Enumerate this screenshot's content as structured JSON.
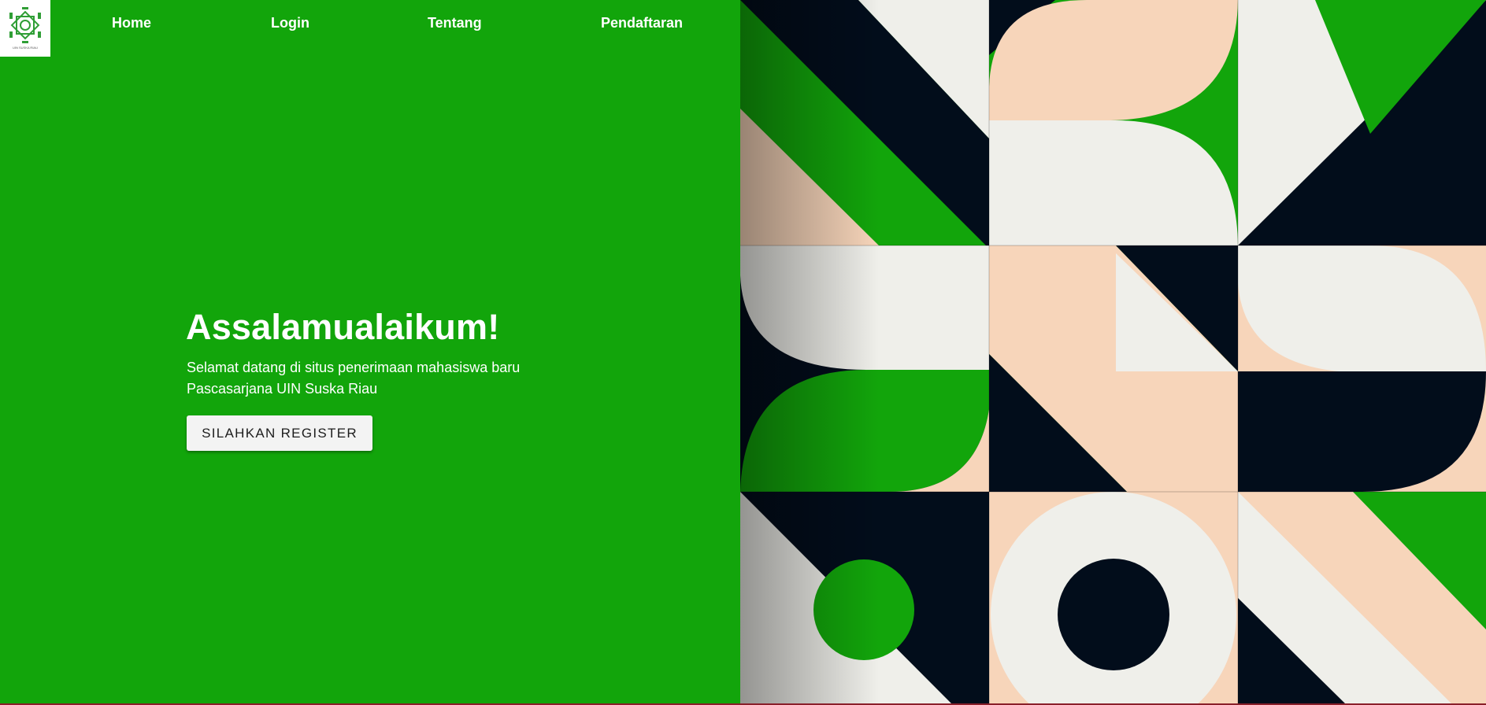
{
  "brand": {
    "logo_icon": "uin-suska-riau-logo-icon",
    "logo_caption": "UIN SUSKA RIAU"
  },
  "nav": {
    "items": [
      {
        "label": "Home"
      },
      {
        "label": "Login"
      },
      {
        "label": "Tentang"
      },
      {
        "label": "Pendaftaran"
      }
    ]
  },
  "hero": {
    "title": "Assalamualaikum!",
    "subtitle": "Selamat datang di situs penerimaan mahasiswa baru Pascasarjana UIN Suska Riau",
    "button_label": "SILAHKAN REGISTER"
  },
  "colors": {
    "primary_green": "#12a50b",
    "dark_navy": "#020d1b",
    "cream": "#efefea",
    "peach": "#f7d5ba",
    "bottom_accent": "#8a1f2a"
  }
}
